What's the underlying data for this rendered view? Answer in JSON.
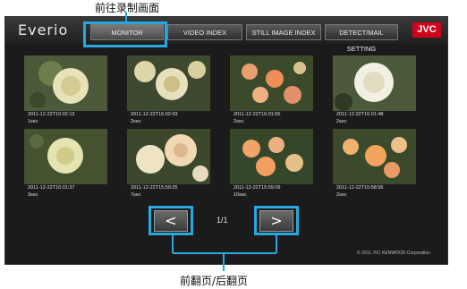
{
  "annotations": {
    "top": "前往录制画面",
    "bottom": "前翻页/后翻页"
  },
  "header": {
    "brand": "Everio",
    "tabs": [
      {
        "label": "MONITOR"
      },
      {
        "label": "VIDEO INDEX"
      },
      {
        "label": "STILL IMAGE INDEX"
      },
      {
        "label": "DETECT/MAIL SETTING"
      }
    ],
    "logo": "JVC"
  },
  "thumbnails": [
    {
      "timestamp": "2011-12-22T16:02:13",
      "duration": "1sec"
    },
    {
      "timestamp": "2011-12-22T16:02:03",
      "duration": "2sec"
    },
    {
      "timestamp": "2011-12-22T16:01:55",
      "duration": "2sec"
    },
    {
      "timestamp": "2011-12-22T16:01:48",
      "duration": "2sec"
    },
    {
      "timestamp": "2011-12-22T16:01:37",
      "duration": "3sec"
    },
    {
      "timestamp": "2011-12-22T15:59:25",
      "duration": "7sec"
    },
    {
      "timestamp": "2011-12-22T15:59:09",
      "duration": "10sec"
    },
    {
      "timestamp": "2011-12-22T15:58:56",
      "duration": "2sec"
    }
  ],
  "pager": {
    "prev": "<",
    "next": ">",
    "page": "1/1"
  },
  "footer": {
    "copyright": "© 2011 JVC KENWOOD Corporation"
  },
  "colors": {
    "accent": "#27a8df",
    "brand_red": "#d0021b",
    "background": "#1b1b1b"
  },
  "icons": {
    "prev": "chevron-left-icon",
    "next": "chevron-right-icon"
  }
}
